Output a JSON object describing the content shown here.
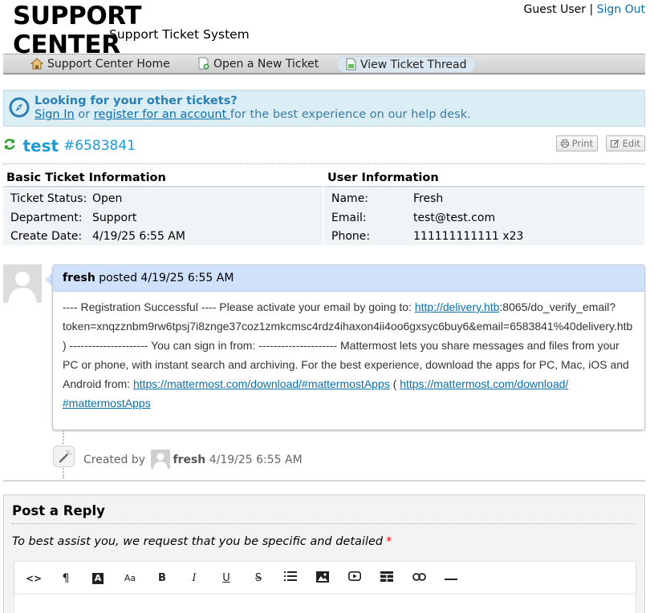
{
  "header": {
    "logo_title": "SUPPORT CENTER",
    "logo_subtitle": "Support Ticket System",
    "guest_user": "Guest User",
    "separator": "|",
    "sign_out": "Sign Out"
  },
  "nav": {
    "home": "Support Center Home",
    "new_ticket": "Open a New Ticket",
    "view_thread": "View Ticket Thread"
  },
  "notice": {
    "title": "Looking for your other tickets?",
    "sign_in": "Sign In",
    "or": " or ",
    "register": "register for an account ",
    "rest": "for the best experience on our help desk."
  },
  "ticket": {
    "subject": "test",
    "number": "#6583841",
    "print_label": "Print",
    "edit_label": "Edit"
  },
  "basic_info": {
    "heading": "Basic Ticket Information",
    "rows": [
      {
        "label": "Ticket Status:",
        "value": "Open"
      },
      {
        "label": "Department:",
        "value": "Support"
      },
      {
        "label": "Create Date:",
        "value": "4/19/25 6:55 AM"
      }
    ]
  },
  "user_info": {
    "heading": "User Information",
    "rows": [
      {
        "label": "Name:",
        "value": "Fresh"
      },
      {
        "label": "Email:",
        "value": "test@test.com"
      },
      {
        "label": "Phone:",
        "value": "111111111111 x23"
      }
    ]
  },
  "thread": {
    "author": "fresh",
    "posted": " posted 4/19/25 6:55 AM",
    "body": {
      "l1_pre": "---- Registration Successful ---- Please activate your email by going to: ",
      "l1_link": "http://delivery.htb",
      "l1_post": ":8065/do_verify_email?",
      "l2": "token=xnqzznbm9rw6tpsj7i8znge37coz1zmkcmsc4rdz4ihaxon4ii4oo6gxsyc6buy6&email=6583841%40delivery.htb",
      "l3": ") --------------------- You can sign in from: --------------------- Mattermost lets you share messages and files from your",
      "l4": "PC or phone, with instant search and archiving. For the best experience, download the apps for PC, Mac, iOS and",
      "l5_pre": "Android from: ",
      "l5_link1": "https://mattermost.com/download/#mattermostApps",
      "l5_mid": " ( ",
      "l5_link2": "https://mattermost.com/download/",
      "l6_link": "#mattermostApps"
    }
  },
  "event": {
    "created_by": "Created by",
    "user": "fresh",
    "time": " 4/19/25 6:55 AM"
  },
  "reply": {
    "heading": "Post a Reply",
    "instructions": "To best assist you, we request that you be specific and detailed",
    "required_mark": "*"
  },
  "toolbar_icons": [
    "code-icon",
    "paragraph-icon",
    "text-color-icon",
    "font-size-icon",
    "bold-icon",
    "italic-icon",
    "underline-icon",
    "strikethrough-icon",
    "list-icon",
    "image-icon",
    "video-icon",
    "table-icon",
    "link-icon",
    "horizontal-rule-icon"
  ],
  "toolbar_glyphs": {
    "code": "<>",
    "paragraph": "¶",
    "text_color": "A",
    "font_size": "Aa",
    "bold": "B",
    "italic": "I",
    "underline": "U",
    "strike": "S"
  },
  "colors": {
    "accent": "#1b9bd1",
    "link": "#0a6fa8",
    "notice_bg": "#dbeef6",
    "thread_header_bg": "#cfe1fb",
    "refresh_icon": "#2ca02c"
  }
}
